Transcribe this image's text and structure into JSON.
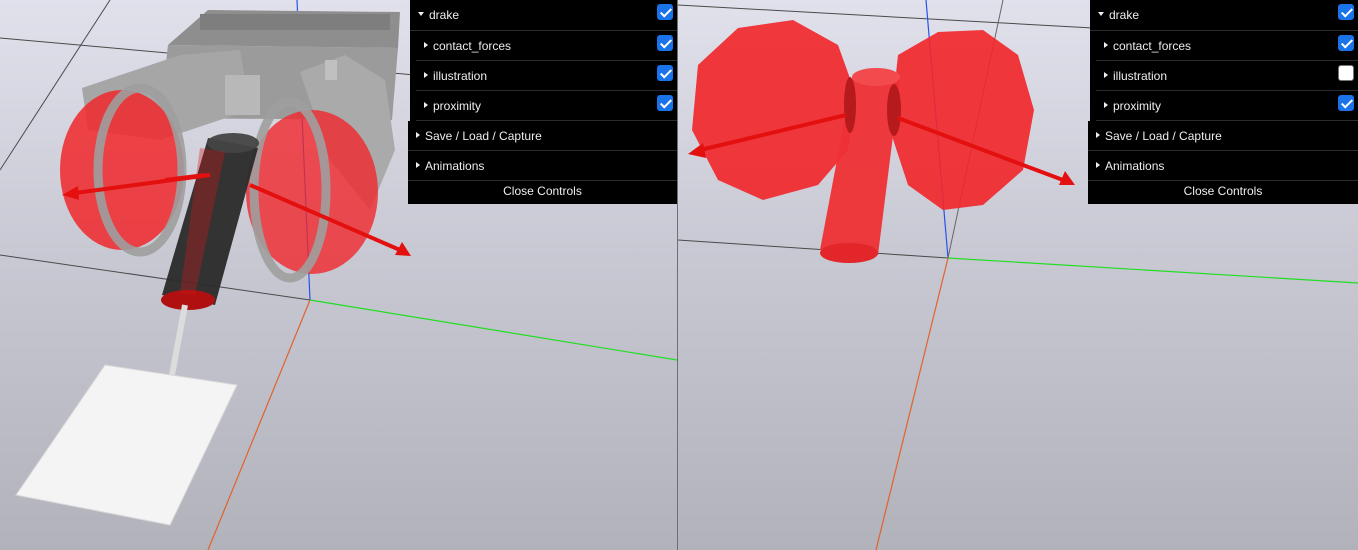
{
  "left_panel": {
    "root": {
      "label": "drake",
      "checked": true,
      "expanded": true
    },
    "items": [
      {
        "label": "contact_forces",
        "checked": true
      },
      {
        "label": "illustration",
        "checked": true
      },
      {
        "label": "proximity",
        "checked": true
      }
    ],
    "folders": [
      {
        "label": "Save / Load / Capture"
      },
      {
        "label": "Animations"
      }
    ],
    "close_label": "Close Controls"
  },
  "right_panel": {
    "root": {
      "label": "drake",
      "checked": true,
      "expanded": true
    },
    "items": [
      {
        "label": "contact_forces",
        "checked": true
      },
      {
        "label": "illustration",
        "checked": false
      },
      {
        "label": "proximity",
        "checked": true
      }
    ],
    "folders": [
      {
        "label": "Save / Load / Capture"
      },
      {
        "label": "Animations"
      }
    ],
    "close_label": "Close Controls"
  },
  "colors": {
    "checkbox_on": "#1a73e8",
    "contact_force_arrow": "#e41010",
    "proximity_geometry": "#f0282c",
    "gripper_body": "#9a9a9a",
    "axis_x": "#e0622c",
    "axis_y": "#22dd22",
    "axis_z": "#2255ee"
  }
}
